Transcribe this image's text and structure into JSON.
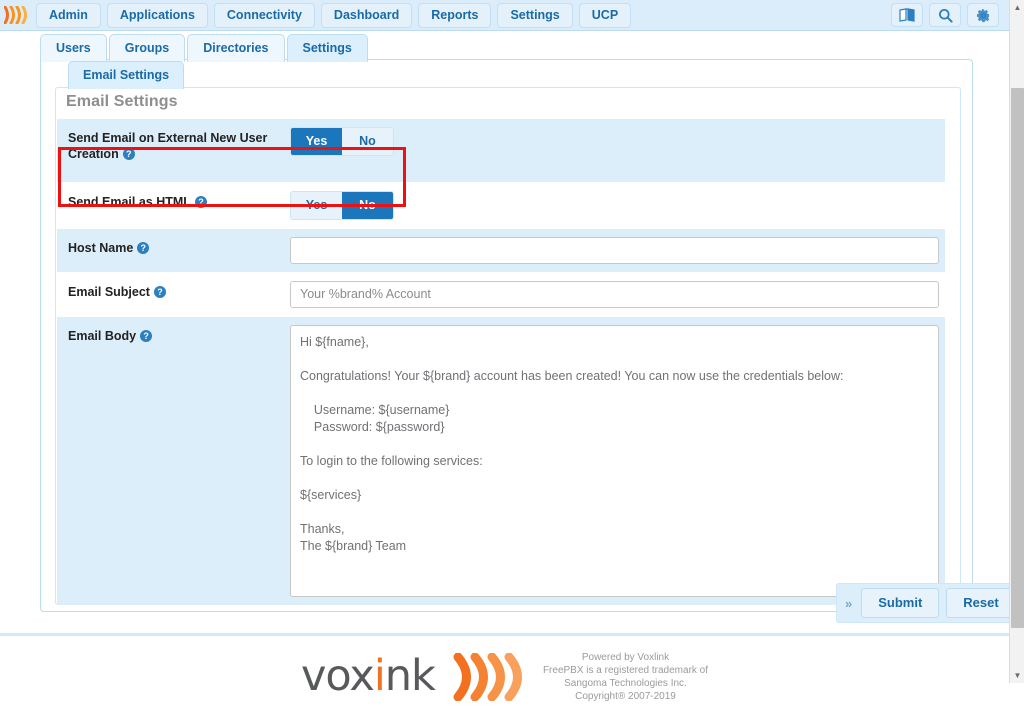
{
  "navbar": {
    "logo_icon": "voxlink-waves-icon",
    "items": [
      {
        "label": "Admin"
      },
      {
        "label": "Applications"
      },
      {
        "label": "Connectivity"
      },
      {
        "label": "Dashboard"
      },
      {
        "label": "Reports"
      },
      {
        "label": "Settings"
      },
      {
        "label": "UCP"
      }
    ],
    "right_icons": [
      {
        "name": "language-book-icon"
      },
      {
        "name": "search-icon"
      },
      {
        "name": "gear-icon"
      }
    ]
  },
  "tabs_primary": [
    {
      "label": "Users",
      "active": false
    },
    {
      "label": "Groups",
      "active": false
    },
    {
      "label": "Directories",
      "active": false
    },
    {
      "label": "Settings",
      "active": true
    }
  ],
  "tabs_secondary": [
    {
      "label": "Email Settings",
      "active": true
    }
  ],
  "section": {
    "title": "Email Settings"
  },
  "form": {
    "rows": [
      {
        "label": "Send Email on External New User Creation",
        "help": "?",
        "type": "toggle",
        "options": [
          "Yes",
          "No"
        ],
        "selected": "Yes",
        "highlighted": true
      },
      {
        "label": "Send Email as HTML",
        "help": "?",
        "type": "toggle",
        "options": [
          "Yes",
          "No"
        ],
        "selected": "No",
        "highlighted": false
      },
      {
        "label": "Host Name",
        "help": "?",
        "type": "text",
        "value": "",
        "placeholder": ""
      },
      {
        "label": "Email Subject",
        "help": "?",
        "type": "text",
        "value": "Your %brand% Account",
        "placeholder": ""
      },
      {
        "label": "Email Body",
        "help": "?",
        "type": "textarea",
        "value": "Hi ${fname},\n\nCongratulations! Your ${brand} account has been created! You can now use the credentials below:\n\n    Username: ${username}\n    Password: ${password}\n\nTo login to the following services:\n\n${services}\n\nThanks,\nThe ${brand} Team"
      }
    ]
  },
  "actions": {
    "expand_label": "»",
    "submit_label": "Submit",
    "reset_label": "Reset"
  },
  "footer": {
    "logo_text_a": "vox",
    "logo_text_i": "i",
    "logo_text_b": "nk",
    "logo_icon": "voxlink-waves-icon",
    "lines": [
      "Powered by Voxlink",
      "FreePBX is a registered trademark of",
      "Sangoma Technologies Inc.",
      "Copyright® 2007-2019"
    ]
  },
  "scrollbar": {
    "up_arrow": "▲",
    "down_arrow": "▼"
  },
  "colors": {
    "accent_blue": "#1c76bc",
    "nav_blue": "#dbedfa",
    "row_shade": "#dceefa",
    "highlight_red": "#ee1111",
    "brand_orange": "#f37021"
  }
}
